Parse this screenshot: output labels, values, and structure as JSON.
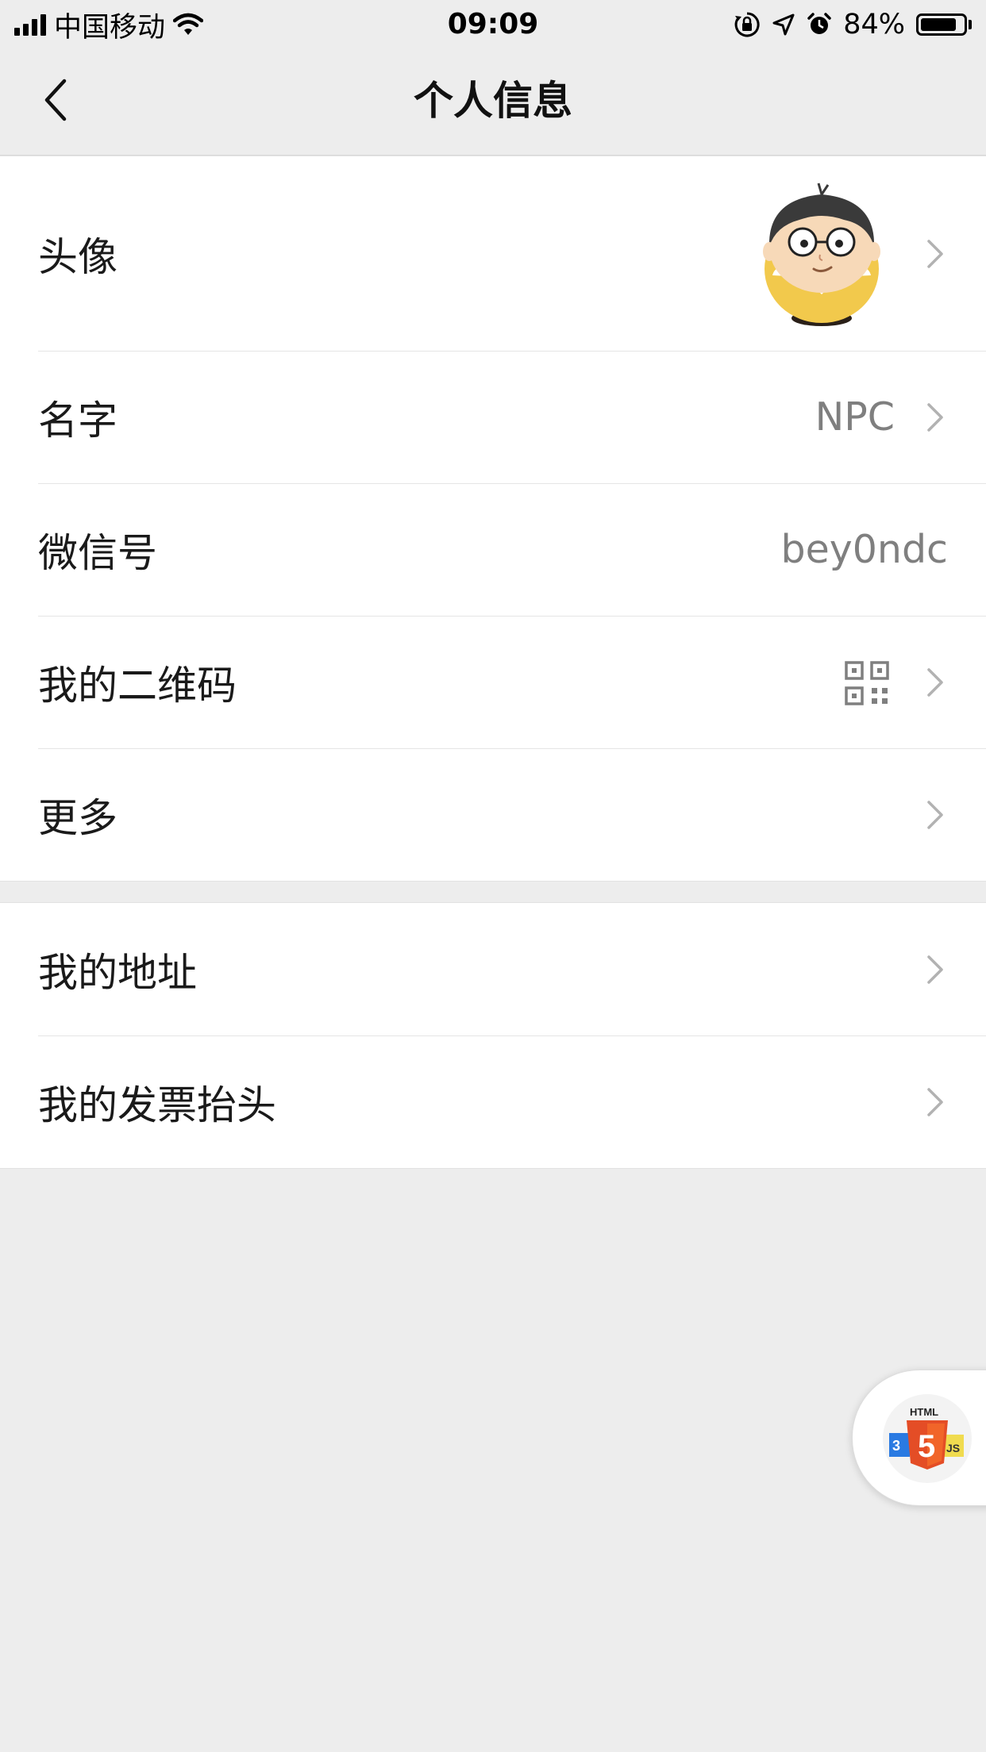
{
  "status_bar": {
    "carrier": "中国移动",
    "time": "09:09",
    "battery": "84%",
    "battery_level": 0.84,
    "icons": [
      "signal-icon",
      "wifi-icon",
      "orientation-lock-icon",
      "location-icon",
      "alarm-icon",
      "battery-icon"
    ]
  },
  "nav": {
    "title": "个人信息",
    "back_icon": "chevron-left-icon"
  },
  "profile": {
    "avatar_label": "头像",
    "name_label": "名字",
    "name_value": "NPC",
    "wechat_id_label": "微信号",
    "wechat_id_value": "bey0ndc",
    "qrcode_label": "我的二维码",
    "more_label": "更多"
  },
  "extra": {
    "address_label": "我的地址",
    "invoice_label": "我的发票抬头"
  },
  "floating_badge": {
    "top_text": "HTML",
    "number": "5",
    "side_text": "JS"
  },
  "colors": {
    "background": "#ededed",
    "cell": "#ffffff",
    "value_text": "#7f7f7f",
    "chevron": "#b2b2b2",
    "html5_orange": "#e44d26",
    "css_blue": "#2a7ae2",
    "js_yellow": "#f0db4f"
  }
}
